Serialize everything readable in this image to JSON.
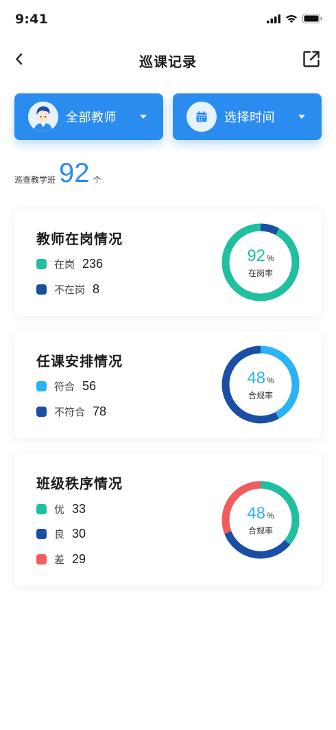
{
  "status_bar": {
    "time": "9:41"
  },
  "nav": {
    "title": "巡课记录"
  },
  "filters": {
    "teacher_label": "全部教师",
    "time_label": "选择时间"
  },
  "summary": {
    "label": "巡查教学班",
    "value": "92",
    "unit": "个"
  },
  "colors": {
    "primary": "#2b8cf0",
    "teal": "#1fbf9f",
    "navy": "#1a4fa3",
    "sky": "#29b3f5",
    "coral": "#f25c5c"
  },
  "cards": [
    {
      "title": "教师在岗情况",
      "legend": [
        {
          "label": "在岗",
          "value": "236",
          "color": "#1fbf9f"
        },
        {
          "label": "不在岗",
          "value": "8",
          "color": "#1a4fa3"
        }
      ],
      "donut": {
        "percent": "92",
        "percent_sign": "%",
        "sublabel": "在岗率",
        "percent_color": "#1fbf9f",
        "segments": [
          {
            "fraction": 0.08,
            "color": "#1a4fa3"
          },
          {
            "fraction": 0.92,
            "color": "#1fbf9f"
          }
        ]
      }
    },
    {
      "title": "任课安排情况",
      "legend": [
        {
          "label": "符合",
          "value": "56",
          "color": "#29b3f5"
        },
        {
          "label": "不符合",
          "value": "78",
          "color": "#1a4fa3"
        }
      ],
      "donut": {
        "percent": "48",
        "percent_sign": "%",
        "sublabel": "合规率",
        "percent_color": "#29b3f5",
        "segments": [
          {
            "fraction": 0.42,
            "color": "#29b3f5"
          },
          {
            "fraction": 0.58,
            "color": "#1a4fa3"
          }
        ]
      }
    },
    {
      "title": "班级秩序情况",
      "legend": [
        {
          "label": "优",
          "value": "33",
          "color": "#1fbf9f"
        },
        {
          "label": "良",
          "value": "30",
          "color": "#1a4fa3"
        },
        {
          "label": "差",
          "value": "29",
          "color": "#f25c5c"
        }
      ],
      "donut": {
        "percent": "48",
        "percent_sign": "%",
        "sublabel": "合规率",
        "percent_color": "#29b3f5",
        "segments": [
          {
            "fraction": 0.36,
            "color": "#1fbf9f"
          },
          {
            "fraction": 0.33,
            "color": "#1a4fa3"
          },
          {
            "fraction": 0.31,
            "color": "#f25c5c"
          }
        ]
      }
    }
  ]
}
